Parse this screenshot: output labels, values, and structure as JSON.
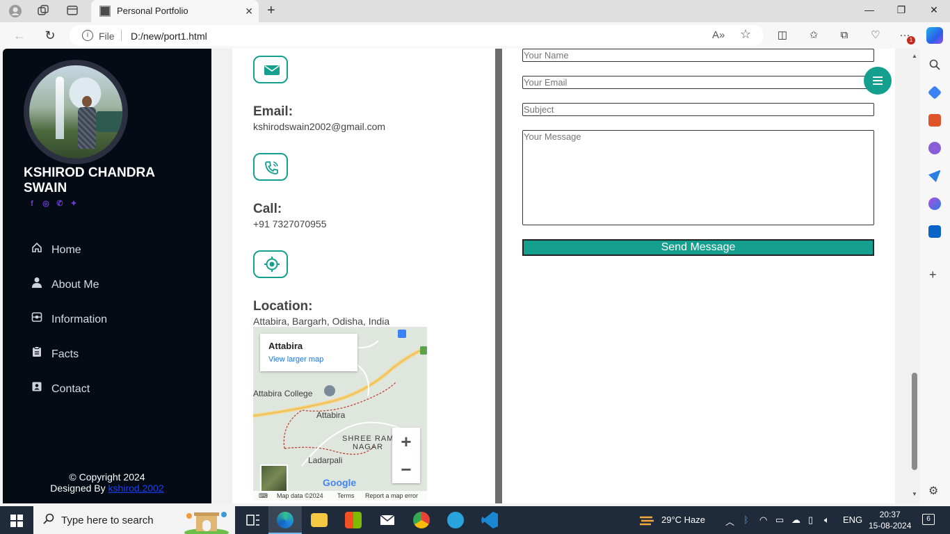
{
  "browser": {
    "tab_title": "Personal Portfolio",
    "url_scheme_label": "File",
    "url": "D:/new/port1.html",
    "notification_badge": "1"
  },
  "sidebar": {
    "name": "KSHIROD CHANDRA SWAIN",
    "social_icons": [
      "facebook-icon",
      "instagram-icon",
      "whatsapp-icon",
      "twitter-icon"
    ],
    "menu": [
      {
        "label": "Home",
        "icon": "home-icon"
      },
      {
        "label": "About Me",
        "icon": "user-icon"
      },
      {
        "label": "Information",
        "icon": "info-icon"
      },
      {
        "label": "Facts",
        "icon": "clipboard-icon"
      },
      {
        "label": "Contact",
        "icon": "contact-icon"
      }
    ],
    "copyright": "© Copyright 2024",
    "designed_by_prefix": "Designed By",
    "designed_by_link": "kshirod.2002"
  },
  "contact_info": {
    "email_title": "Email:",
    "email_value": "kshirodswain2002@gmail.com",
    "call_title": "Call:",
    "call_value": "+91 7327070955",
    "location_title": "Location:",
    "location_value": "Attabira, Bargarh, Odisha, India"
  },
  "map": {
    "card_title": "Attabira",
    "card_link": "View larger map",
    "labels": [
      "Attabira College",
      "Attabira",
      "SHREE RAM",
      "NAGAR",
      "Ladarpali"
    ],
    "zoom_in": "+",
    "zoom_out": "−",
    "brand": "Google",
    "footer": [
      "Map data ©2024",
      "Terms",
      "Report a map error"
    ]
  },
  "form": {
    "name_placeholder": "Your Name",
    "email_placeholder": "Your Email",
    "subject_placeholder": "Subject",
    "message_placeholder": "Your Message",
    "submit_label": "Send Message"
  },
  "taskbar": {
    "search_placeholder": "Type here to search",
    "weather": "29°C  Haze",
    "language": "ENG",
    "time": "20:37",
    "date": "15-08-2024",
    "notification_count": "6"
  },
  "colors": {
    "accent": "#149f8f",
    "sidebar_bg": "#040b14",
    "social": "#6f3bd8"
  }
}
